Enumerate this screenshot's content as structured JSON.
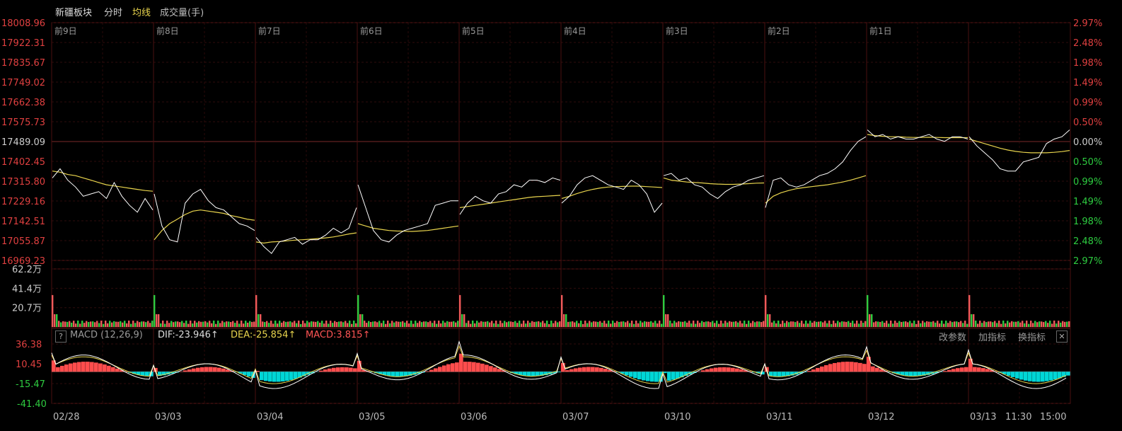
{
  "toolbar": {
    "title": "新疆板块",
    "tab_timeshare": "分时",
    "tab_avgline": "均线",
    "tab_volume": "成交量(手)"
  },
  "macd_panel": {
    "name": "MACD (12,26,9)",
    "dif_label": "DIF:-23.946↑",
    "dea_label": "DEA:-25.854↑",
    "macd_label": "MACD:3.815↑",
    "btn_params": "改参数",
    "btn_add": "加指标",
    "btn_switch": "换指标",
    "help": "?",
    "close": "✕"
  },
  "colors": {
    "up": "#ff4d4d",
    "down": "#00d6d6",
    "vol_up": "#f05a5a",
    "vol_down": "#2ecc40",
    "price_line": "#ffffff",
    "avg_line": "#e8d44d",
    "dea_line": "#e8d44d",
    "grid": "#3a1010",
    "axis_text": "#e04040"
  },
  "chart_data": {
    "type": "line",
    "day_labels": [
      "前9日",
      "前8日",
      "前7日",
      "前6日",
      "前5日",
      "前4日",
      "前3日",
      "前2日",
      "前1日"
    ],
    "x_dates": [
      "02/28",
      "03/03",
      "03/04",
      "03/05",
      "03/06",
      "03/07",
      "03/10",
      "03/11",
      "03/12",
      "03/13"
    ],
    "x_time_labels": [
      "11:30",
      "15:00"
    ],
    "price_ticks": [
      "18008.96",
      "17922.31",
      "17835.67",
      "17749.02",
      "17662.38",
      "17575.73",
      "17489.09",
      "17402.45",
      "17315.80",
      "17229.16",
      "17142.51",
      "17055.87",
      "16969.23"
    ],
    "pct_ticks": [
      "2.97%",
      "2.48%",
      "1.98%",
      "1.49%",
      "0.99%",
      "0.50%",
      "0.00%",
      "0.50%",
      "0.99%",
      "1.49%",
      "1.98%",
      "2.48%",
      "2.97%"
    ],
    "ylim": [
      16969.23,
      18008.96
    ],
    "volume_ticks": [
      "62.2万",
      "41.4万",
      "20.7万"
    ],
    "volume_max": 62.2,
    "macd_ticks": [
      "36.38",
      "10.45",
      "-15.47",
      "-41.40"
    ],
    "macd_ylim": [
      -41.4,
      36.38
    ],
    "days": [
      {
        "price": [
          17330,
          17370,
          17320,
          17290,
          17250,
          17260,
          17270,
          17240,
          17310,
          17250,
          17210,
          17180,
          17240,
          17190
        ],
        "avg": [
          17360,
          17355,
          17345,
          17340,
          17330,
          17320,
          17310,
          17300,
          17295,
          17290,
          17285,
          17280,
          17275,
          17272
        ]
      },
      {
        "price": [
          17260,
          17120,
          17060,
          17050,
          17220,
          17260,
          17280,
          17230,
          17200,
          17190,
          17160,
          17130,
          17120,
          17100
        ],
        "avg": [
          17060,
          17100,
          17130,
          17150,
          17170,
          17185,
          17190,
          17185,
          17180,
          17175,
          17165,
          17158,
          17150,
          17145
        ]
      },
      {
        "price": [
          17070,
          17030,
          17000,
          17050,
          17060,
          17070,
          17040,
          17060,
          17060,
          17080,
          17110,
          17090,
          17110,
          17200
        ],
        "avg": [
          17050,
          17045,
          17050,
          17052,
          17055,
          17058,
          17060,
          17062,
          17065,
          17068,
          17072,
          17078,
          17085,
          17090
        ]
      },
      {
        "price": [
          17300,
          17200,
          17100,
          17060,
          17050,
          17080,
          17100,
          17110,
          17120,
          17130,
          17210,
          17220,
          17230,
          17230
        ],
        "avg": [
          17130,
          17120,
          17110,
          17105,
          17100,
          17098,
          17097,
          17096,
          17098,
          17100,
          17105,
          17110,
          17115,
          17120
        ]
      },
      {
        "price": [
          17170,
          17220,
          17250,
          17230,
          17220,
          17260,
          17270,
          17300,
          17290,
          17320,
          17320,
          17310,
          17330,
          17320
        ],
        "avg": [
          17200,
          17205,
          17210,
          17215,
          17220,
          17225,
          17230,
          17235,
          17240,
          17245,
          17248,
          17250,
          17252,
          17254
        ]
      },
      {
        "price": [
          17220,
          17250,
          17300,
          17330,
          17340,
          17320,
          17300,
          17290,
          17280,
          17320,
          17300,
          17260,
          17180,
          17220
        ],
        "avg": [
          17240,
          17250,
          17262,
          17272,
          17280,
          17286,
          17290,
          17292,
          17293,
          17294,
          17294,
          17292,
          17290,
          17288
        ]
      },
      {
        "price": [
          17340,
          17350,
          17320,
          17330,
          17300,
          17290,
          17260,
          17240,
          17270,
          17290,
          17300,
          17320,
          17330,
          17340
        ],
        "avg": [
          17330,
          17320,
          17316,
          17312,
          17310,
          17308,
          17305,
          17303,
          17302,
          17302,
          17303,
          17305,
          17307,
          17308
        ]
      },
      {
        "price": [
          17200,
          17320,
          17330,
          17300,
          17290,
          17300,
          17320,
          17340,
          17350,
          17370,
          17400,
          17450,
          17490,
          17510
        ],
        "avg": [
          17220,
          17250,
          17265,
          17275,
          17283,
          17288,
          17292,
          17296,
          17300,
          17306,
          17312,
          17320,
          17330,
          17340
        ]
      },
      {
        "price": [
          17540,
          17510,
          17520,
          17500,
          17510,
          17500,
          17500,
          17510,
          17520,
          17500,
          17490,
          17510,
          17510,
          17500
        ],
        "avg": [
          17520,
          17515,
          17512,
          17510,
          17510,
          17508,
          17507,
          17507,
          17508,
          17507,
          17506,
          17506,
          17506,
          17506
        ]
      },
      {
        "price": [
          17510,
          17470,
          17440,
          17410,
          17370,
          17360,
          17360,
          17400,
          17410,
          17420,
          17480,
          17500,
          17510,
          17540
        ],
        "avg": [
          17500,
          17490,
          17480,
          17470,
          17460,
          17452,
          17446,
          17442,
          17440,
          17440,
          17440,
          17442,
          17445,
          17450
        ]
      }
    ]
  }
}
